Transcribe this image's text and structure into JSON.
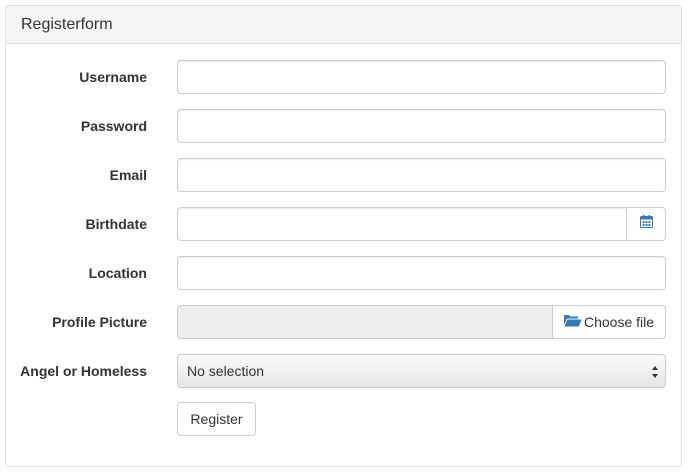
{
  "panel": {
    "title": "Registerform"
  },
  "form": {
    "username": {
      "label": "Username",
      "value": ""
    },
    "password": {
      "label": "Password",
      "value": ""
    },
    "email": {
      "label": "Email",
      "value": ""
    },
    "birthdate": {
      "label": "Birthdate",
      "value": "",
      "icon": "calendar-icon"
    },
    "location": {
      "label": "Location",
      "value": ""
    },
    "profile_picture": {
      "label": "Profile Picture",
      "button_label": "Choose file",
      "icon": "folder-open-icon"
    },
    "angel_or_homeless": {
      "label": "Angel or Homeless",
      "selected": "No selection"
    },
    "submit_label": "Register"
  },
  "colors": {
    "icon_blue": "#337ab7",
    "border": "#cccccc",
    "heading_bg": "#f5f5f5",
    "disabled_bg": "#eeeeee"
  }
}
